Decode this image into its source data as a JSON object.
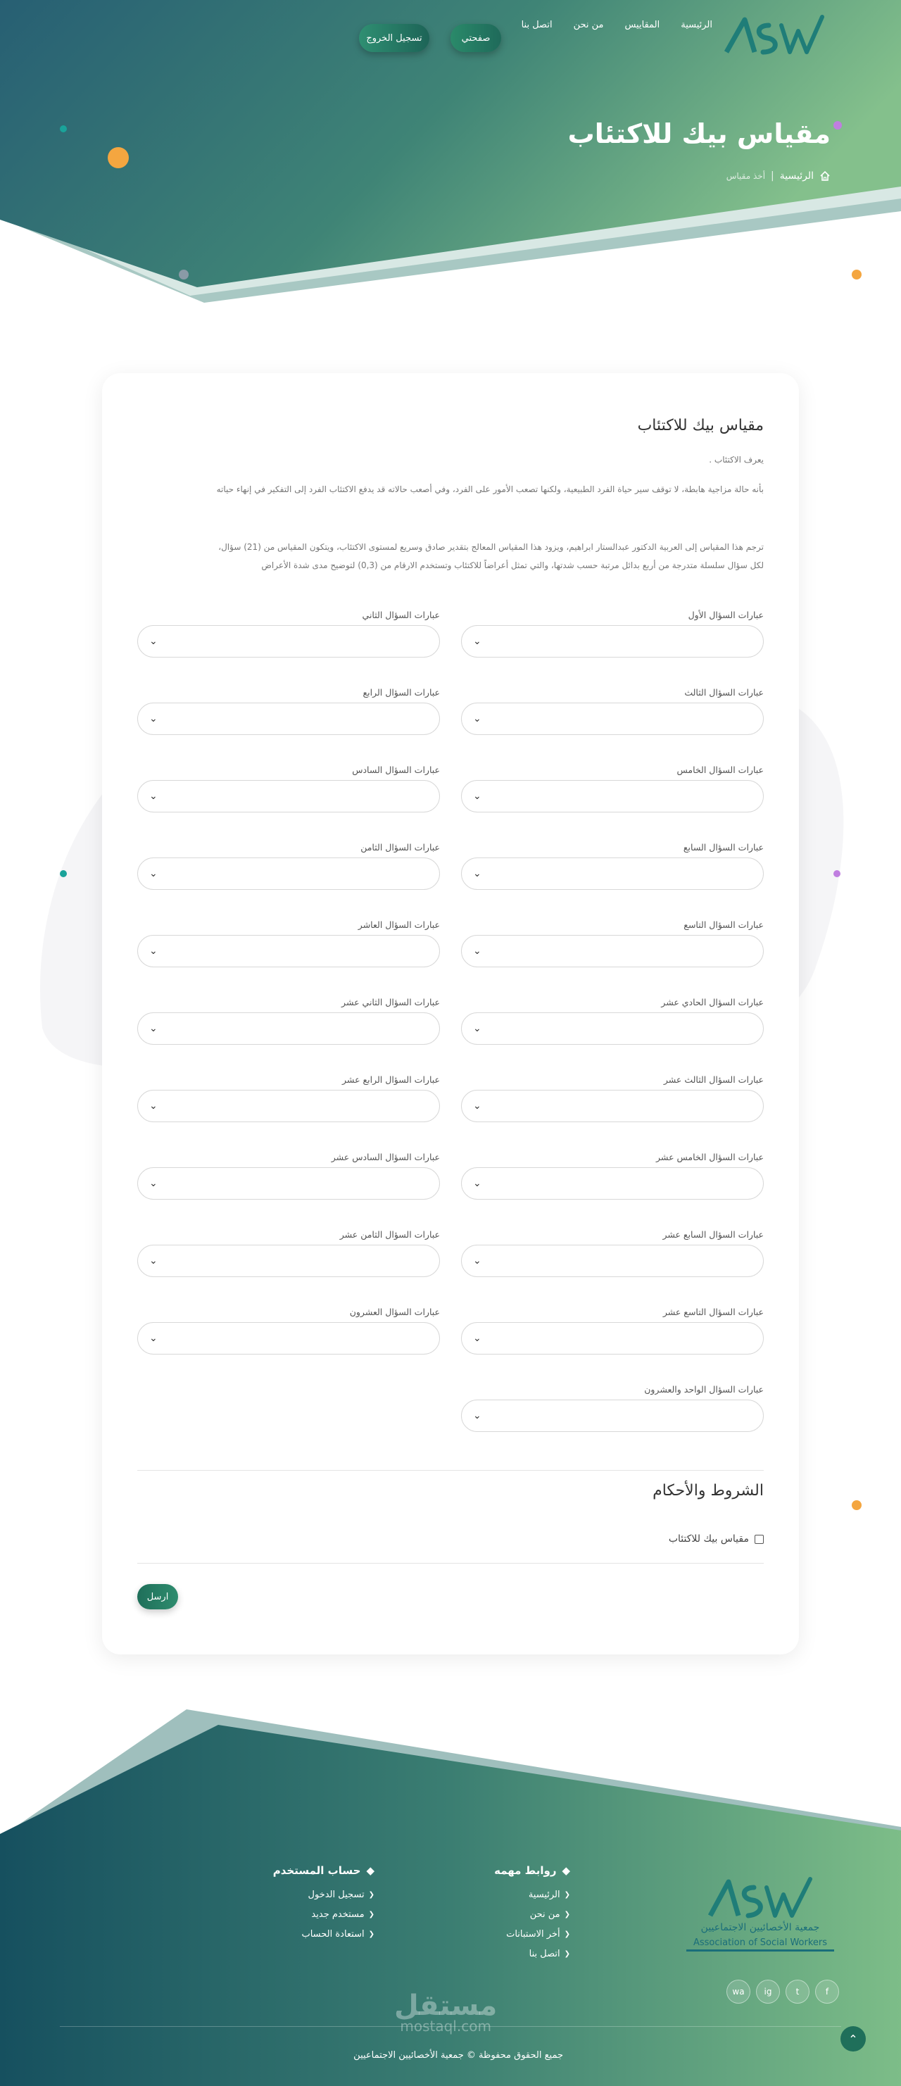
{
  "nav": {
    "logo_text": "ASW",
    "links": [
      "الرئيسية",
      "المقاييس",
      "من نحن",
      "اتصل بنا"
    ],
    "my_page": "صفحتي",
    "logout": "تسجيل الخروج"
  },
  "hero": {
    "title": "مقياس بيك للاكتئاب",
    "breadcrumb_home": "الرئيسية",
    "breadcrumb_sep": "|",
    "breadcrumb_current": "أخذ مقياس"
  },
  "form": {
    "title": "مقياس بيك للاكتئاب",
    "intro_1": "يعرف الاكتئاب .",
    "intro_2": "بأنه حالة مزاجية هابطة، لا توقف سير حياة الفرد الطبيعية، ولكنها تصعب الأمور على الفرد، وفي أصعب حالاته قد يدفع الاكتئاب الفرد إلى التفكير في إنهاء حياته",
    "intro_3": "ترجم هذا المقياس إلى العربية الدكتور عبدالستار ابراهيم، ويزود هذا المقياس المعالج بتقدير صادق وسريع لمستوى الاكتئاب، ويتكون المقياس من (21) سؤال،",
    "intro_4": "لكل سؤال سلسلة متدرجة من أربع بدائل مرتبة حسب شدتها، والتي تمثل أعراضاً للاكتئاب وتستخدم الارقام من (0,3) لتوضيح مدى شدة الأعراض",
    "questions": [
      "عبارات السؤال الأول",
      "عبارات السؤال الثاني",
      "عبارات السؤال الثالث",
      "عبارات السؤال الرابع",
      "عبارات السؤال الخامس",
      "عبارات السؤال السادس",
      "عبارات السؤال السابع",
      "عبارات السؤال الثامن",
      "عبارات السؤال التاسع",
      "عبارات السؤال العاشر",
      "عبارات السؤال الحادي عشر",
      "عبارات السؤال الثاني عشر",
      "عبارات السؤال الثالث عشر",
      "عبارات السؤال الرابع عشر",
      "عبارات السؤال الخامس عشر",
      "عبارات السؤال السادس عشر",
      "عبارات السؤال السابع عشر",
      "عبارات السؤال الثامن عشر",
      "عبارات السؤال التاسع عشر",
      "عبارات السؤال العشرون",
      "عبارات السؤال الواحد والعشرون"
    ],
    "chevron": "⌄",
    "terms_title": "الشروط والأحكام",
    "terms_checkbox_label": "مقياس بيك للاكتئاب",
    "submit": "ارسل"
  },
  "footer": {
    "logo_text": "ASW",
    "org_name_ar": "جمعية الأخصائيين الاجتماعيين",
    "org_name_en": "Association of Social Workers",
    "links_title": "روابط مهمه",
    "links": [
      "الرئيسية",
      "من نحن",
      "أخر الاستبانات",
      "اتصل بنا"
    ],
    "account_title": "حساب المستخدم",
    "account_links": [
      "تسجيل الدخول",
      "مستخدم جديد",
      "استعادة الحساب"
    ],
    "social": [
      "f",
      "t",
      "ig",
      "wa"
    ],
    "copyright": "جميع الحقوق محفوظة © جمعية الأخصائيين الاجتماعيين",
    "watermark_ar": "مستقل",
    "watermark_en": "mostaql.com",
    "to_top": "⌃"
  },
  "colors": {
    "teal_dark": "#1b5a68",
    "green_light": "#7fbf8a",
    "accent_orange": "#f4a640",
    "accent_pink": "#f27d8a",
    "accent_purple": "#c07ee0",
    "accent_teal": "#1aa39a"
  }
}
